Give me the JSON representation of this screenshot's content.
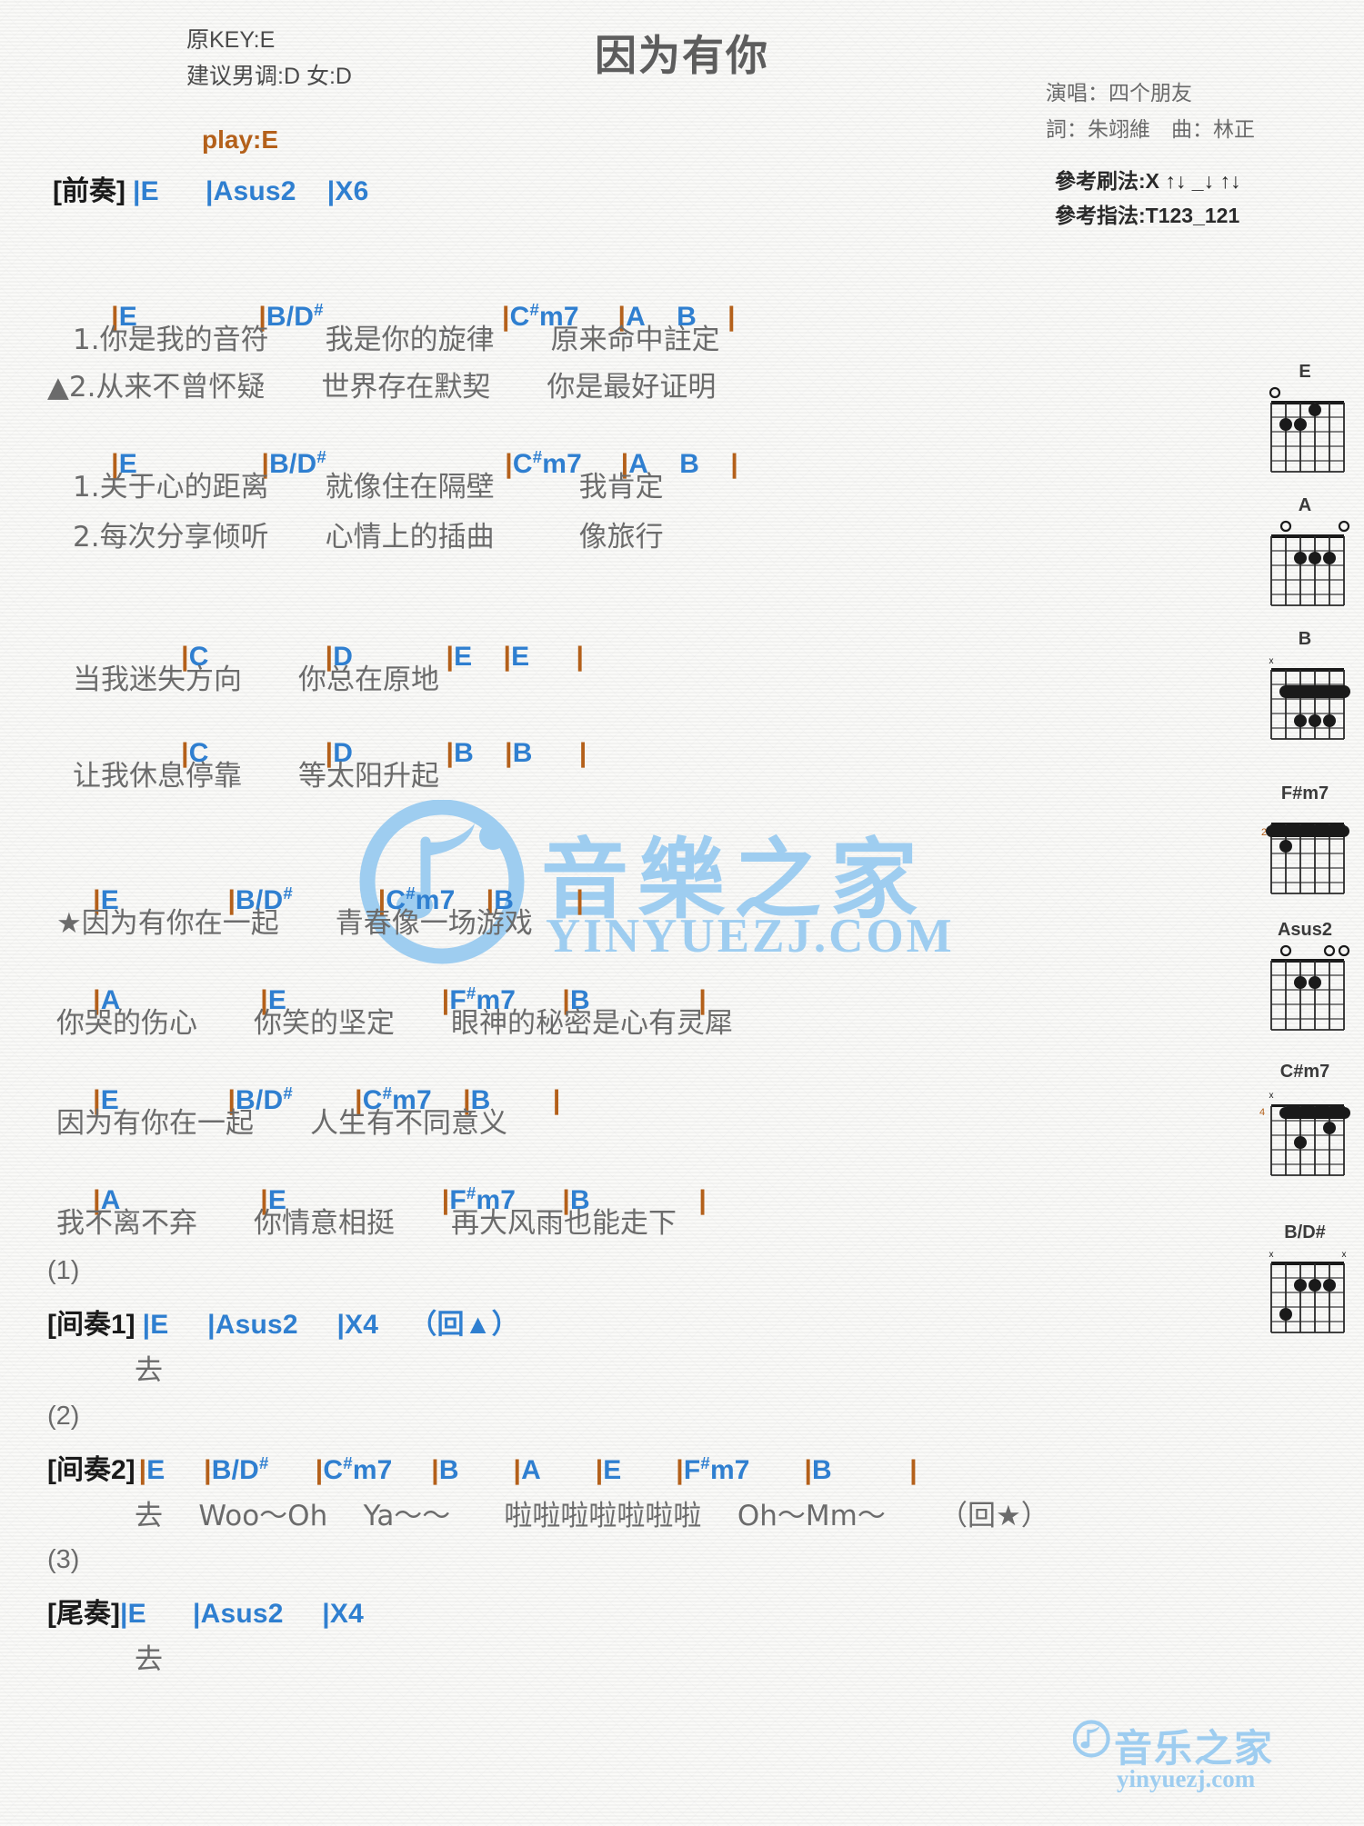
{
  "header": {
    "original_key": "原KEY:E",
    "suggested_key": "建议男调:D 女:D",
    "play_key": "play:E",
    "title": "因为有你",
    "singer": "演唱：四个朋友",
    "credits": "詞：朱翊維　曲：林正",
    "strum_pattern": "參考刷法:X ↑↓ _↓ ↑↓",
    "finger_pattern": "參考指法:T123_121"
  },
  "watermark": {
    "center_text": "音樂之家",
    "center_sub": "YINYUEZJ.COM",
    "bottom_text": "音乐之家",
    "bottom_sub": "yinyuezj.com"
  },
  "sections": {
    "intro": {
      "tag": "[前奏]",
      "chords": "|E      |Asus2    |X6"
    },
    "verse1": {
      "chord_line": "|E            |B/D#                    |C#m7    |A    B    |",
      "lyric1": "1.你是我的音符　　我是你的旋律　　原来命中註定",
      "lyric2": "▲2.从来不曾怀疑　　世界存在默契　　你是最好证明"
    },
    "verse2": {
      "chord_line": "|E            |B/D#                    |C#m7    |A    B    |",
      "lyric1": "1.关于心的距离　　就像住在隔壁　　　我肯定",
      "lyric2": "2.每次分享倾听　　心情上的插曲　　　像旅行"
    },
    "prechorus": {
      "chord_line1": "|C              |D            |E    |E      |",
      "lyric1": "当我迷失方向　　你总在原地",
      "chord_line2": "|C              |D            |B    |B      |",
      "lyric2": "让我休息停靠　　等太阳升起"
    },
    "chorus": {
      "chord_line1": "|E            |B/D#        |C#m7    |B        |",
      "lyric1": "★因为有你在一起　　青春像一场游戏",
      "chord_line2": "|A                  |E                    |F#m7      |B              |",
      "lyric2": "你哭的伤心　　你笑的坚定　　眼神的秘密是心有灵犀",
      "chord_line3": "|E            |B/D#      |C#m7    |B        |",
      "lyric3": "因为有你在一起　　人生有不同意义",
      "chord_line4": "|A                  |E                    |F#m7      |B              |",
      "lyric4": "我不离不弃　　你情意相挺　　再大风雨也能走下"
    },
    "interlude1": {
      "number": "(1)",
      "tag": "[间奏1]",
      "chords": "|E     |Asus2     |X4    （回▲）",
      "lyric": "去"
    },
    "interlude2": {
      "number": "(2)",
      "tag": "[间奏2]",
      "chords": "|E     |B/D#      |C#m7     |B       |A       |E       |F#m7       |B          |",
      "lyric": "去    Woo～Oh    Ya～～      啦啦啦啦啦啦啦    Oh～Mm～      （回★）"
    },
    "outro": {
      "number": "(3)",
      "tag": "[尾奏]",
      "chords": "|E      |Asus2     |X4",
      "lyric": "去"
    }
  },
  "chord_diagrams": [
    {
      "name": "E",
      "position": "",
      "open_strings": [
        1
      ],
      "muted_strings": [],
      "barre": null,
      "dots": [
        {
          "string": 3,
          "fret": 1
        },
        {
          "string": 4,
          "fret": 2
        },
        {
          "string": 5,
          "fret": 2
        }
      ]
    },
    {
      "name": "A",
      "position": "",
      "open_strings": [
        2,
        6
      ],
      "muted_strings": [],
      "barre": null,
      "dots": [
        {
          "string": 3,
          "fret": 2
        },
        {
          "string": 4,
          "fret": 2
        },
        {
          "string": 5,
          "fret": 2
        }
      ]
    },
    {
      "name": "B",
      "position": "",
      "open_strings": [],
      "muted_strings": [
        1
      ],
      "barre": {
        "fret": 2,
        "from": 2,
        "to": 6
      },
      "dots": [
        {
          "string": 3,
          "fret": 4
        },
        {
          "string": 4,
          "fret": 4
        },
        {
          "string": 5,
          "fret": 4
        }
      ]
    },
    {
      "name": "F#m7",
      "position": "2",
      "open_strings": [],
      "muted_strings": [],
      "barre": {
        "fret": 1,
        "from": 1,
        "to": 6
      },
      "dots": [
        {
          "string": 2,
          "fret": 2
        }
      ]
    },
    {
      "name": "Asus2",
      "position": "",
      "open_strings": [
        2,
        5,
        6
      ],
      "muted_strings": [],
      "barre": null,
      "dots": [
        {
          "string": 3,
          "fret": 2
        },
        {
          "string": 4,
          "fret": 2
        }
      ]
    },
    {
      "name": "C#m7",
      "position": "4",
      "open_strings": [],
      "muted_strings": [
        1
      ],
      "barre": {
        "fret": 1,
        "from": 2,
        "to": 6
      },
      "dots": [
        {
          "string": 5,
          "fret": 2
        },
        {
          "string": 3,
          "fret": 3
        }
      ]
    },
    {
      "name": "B/D#",
      "position": "",
      "open_strings": [],
      "muted_strings": [
        1,
        6
      ],
      "barre": null,
      "dots": [
        {
          "string": 3,
          "fret": 2
        },
        {
          "string": 4,
          "fret": 2
        },
        {
          "string": 5,
          "fret": 2
        },
        {
          "string": 2,
          "fret": 4
        }
      ]
    }
  ]
}
